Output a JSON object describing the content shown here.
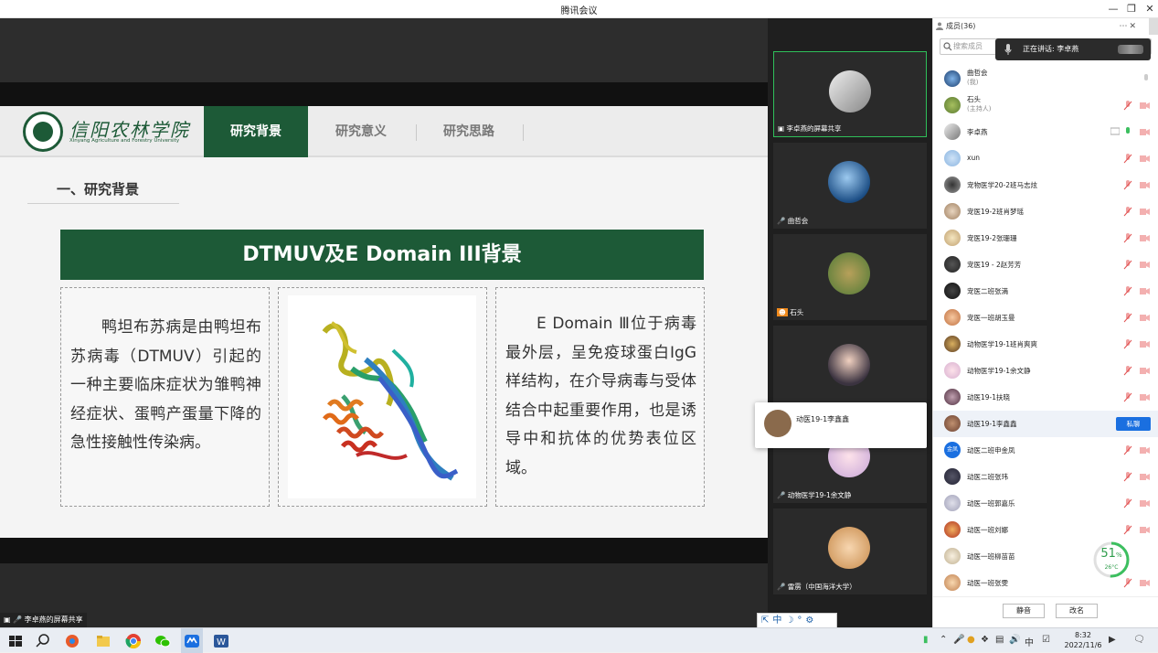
{
  "window": {
    "title": "腾讯会议"
  },
  "slide": {
    "logo_cn": "信阳农林学院",
    "logo_en": "Xinyang Agriculture and Forestry University",
    "tabs": [
      {
        "label": "研究背景",
        "active": true
      },
      {
        "label": "研究意义",
        "active": false
      },
      {
        "label": "研究思路",
        "active": false
      }
    ],
    "section_title": "一、研究背景",
    "banner": "DTMUV及E Domain III背景",
    "left_text": "鸭坦布苏病是由鸭坦布苏病毒（DTMUV）引起的一种主要临床症状为雏鸭神经症状、蛋鸭产蛋量下降的急性接触性传染病。",
    "right_text": "E Domain Ⅲ位于病毒最外层，呈免疫球蛋白IgG样结构，在介导病毒与受体结合中起重要作用，也是诱导中和抗体的优势表位区域。",
    "accent_color": "#1d5a37"
  },
  "screen_share_label": "李卓燕的屏幕共享",
  "video_tiles": [
    {
      "label": "李卓燕的屏幕共享",
      "active": true
    },
    {
      "label": "曲哲会",
      "active": false
    },
    {
      "label": "石头",
      "active": false
    },
    {
      "label": "",
      "active": false
    },
    {
      "label": "动物医学19-1余文静",
      "active": false
    },
    {
      "label": "雷雳（中国海洋大学）",
      "active": false
    }
  ],
  "popup": {
    "name": "动医19-1李鑫鑫"
  },
  "panel": {
    "title": "成员(36)",
    "search_placeholder": "搜索成员",
    "speaking": "正在讲话: 李卓燕",
    "members": [
      {
        "name": "曲哲会",
        "sub": "(我)"
      },
      {
        "name": "石头",
        "sub": "(主持人)"
      },
      {
        "name": "李卓燕",
        "sub": ""
      },
      {
        "name": "xun",
        "sub": ""
      },
      {
        "name": "宠物医学20-2班马志炫",
        "sub": ""
      },
      {
        "name": "宠医19-2班肖梦瑶",
        "sub": ""
      },
      {
        "name": "宠医19-2张珊珊",
        "sub": ""
      },
      {
        "name": "宠医19 - 2赵芳芳",
        "sub": ""
      },
      {
        "name": "宠医二班张満",
        "sub": ""
      },
      {
        "name": "宠医一班胡玉曼",
        "sub": ""
      },
      {
        "name": "动物医学19-1班肖爽爽",
        "sub": ""
      },
      {
        "name": "动物医学19-1余文静",
        "sub": ""
      },
      {
        "name": "动医19-1扶晓",
        "sub": ""
      },
      {
        "name": "动医19-1李鑫鑫",
        "sub": ""
      },
      {
        "name": "动医二班申金凤",
        "sub": ""
      },
      {
        "name": "动医二班张玮",
        "sub": ""
      },
      {
        "name": "动医一班郭嘉乐",
        "sub": ""
      },
      {
        "name": "动医一班刘娜",
        "sub": ""
      },
      {
        "name": "动医一班柳苗苗",
        "sub": ""
      },
      {
        "name": "动医一班张雯",
        "sub": ""
      }
    ],
    "rename_label": "私聊",
    "mute_all": "静音",
    "rename_all": "改名"
  },
  "gauge": {
    "percent": "51",
    "unit": "%",
    "temp": "26°C"
  },
  "ime_text": "中",
  "clock": {
    "time": "8:32",
    "date": "2022/11/6"
  },
  "tray_ime": "中"
}
